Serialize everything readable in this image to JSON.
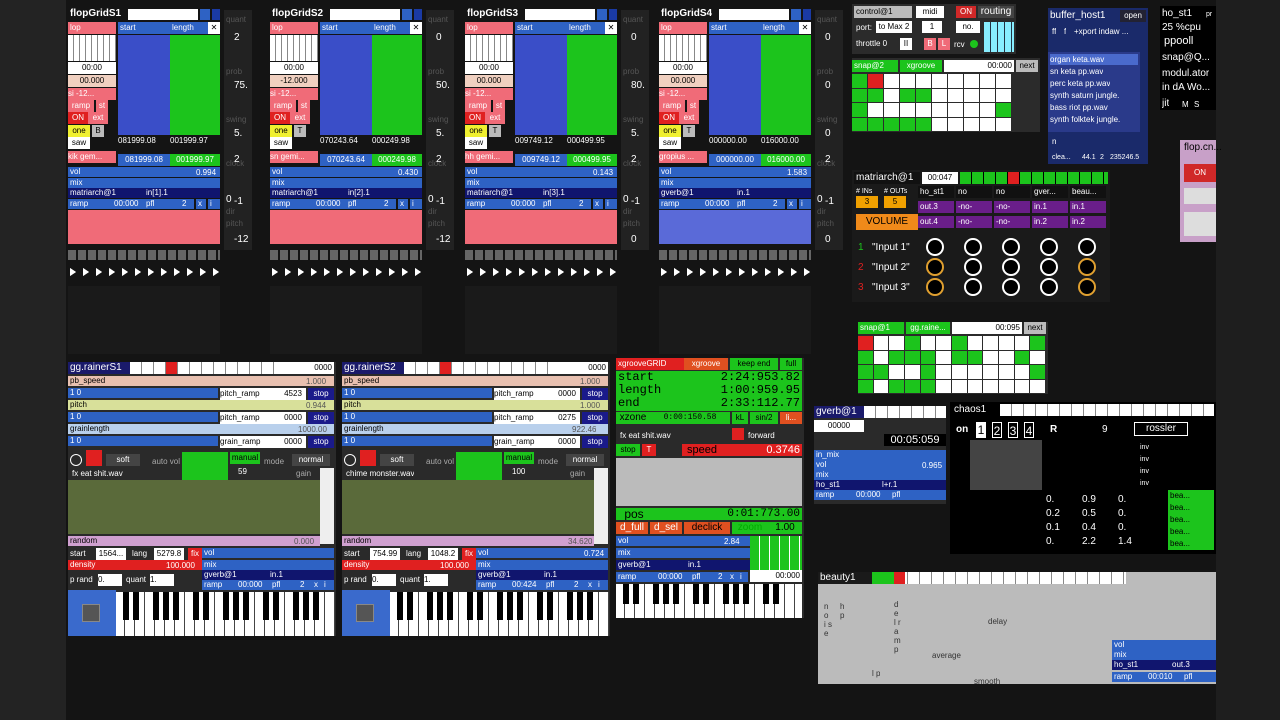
{
  "flopgrids": [
    {
      "title": "flopGridS1",
      "tab_lop": "lop",
      "tab_start": "start",
      "tab_length": "length",
      "time": "00:00",
      "val": "00.000",
      "si": "si -12...",
      "ramp": "ramp",
      "st": "st",
      "on": "ON",
      "ext": "ext",
      "one": "one",
      "b": "B",
      "saw": "saw",
      "name": "kik gem...",
      "n1": "081999.08",
      "n2": "001999.97",
      "n3": "081999.08",
      "n4": "001999.97",
      "vol": "vol",
      "volv": "0.994",
      "mix": "mix",
      "route": "matriarch@1",
      "input": "in[1].1",
      "ramprow": "ramp",
      "rampt": "00:000",
      "pfl": "pfl",
      "two": "2",
      "x": "x",
      "i": "i",
      "side": [
        "quant",
        "2",
        "prob",
        "75.",
        "swing",
        "5.",
        "clock",
        "2",
        "0",
        "-1",
        "dir",
        "pitch",
        "-12"
      ]
    },
    {
      "title": "flopGridS2",
      "tab_lop": "lop",
      "tab_start": "start",
      "tab_length": "length",
      "time": "00:00",
      "val": "-12.000",
      "si": "si -12...",
      "ramp": "ramp",
      "st": "st",
      "on": "ON",
      "ext": "ext",
      "one": "one",
      "b": "T",
      "saw": "saw",
      "name": "sn gemi...",
      "n1": "070243.64",
      "n2": "000249.98",
      "n3": "070243.64",
      "n4": "000249.98",
      "vol": "vol",
      "volv": "0.430",
      "mix": "mix",
      "route": "matriarch@1",
      "input": "in[2].1",
      "ramprow": "ramp",
      "rampt": "00:000",
      "pfl": "pfl",
      "two": "2",
      "x": "x",
      "i": "i",
      "side": [
        "quant",
        "0",
        "prob",
        "50.",
        "swing",
        "5.",
        "clock",
        "2",
        "0",
        "-1",
        "dir",
        "pitch",
        "-12"
      ]
    },
    {
      "title": "flopGridS3",
      "tab_lop": "lop",
      "tab_start": "start",
      "tab_length": "length",
      "time": "00:00",
      "val": "00.000",
      "si": "si -12...",
      "ramp": "ramp",
      "st": "st",
      "on": "ON",
      "ext": "ext",
      "one": "one",
      "b": "T",
      "saw": "saw",
      "name": "hh gemi...",
      "n1": "009749.12",
      "n2": "000499.95",
      "n3": "009749.12",
      "n4": "000499.95",
      "vol": "vol",
      "volv": "0.143",
      "mix": "mix",
      "route": "matriarch@1",
      "input": "in[3].1",
      "ramprow": "ramp",
      "rampt": "00:000",
      "pfl": "pfl",
      "two": "2",
      "x": "x",
      "i": "i",
      "side": [
        "quant",
        "0",
        "prob",
        "80.",
        "swing",
        "5.",
        "clock",
        "2",
        "0",
        "-1",
        "dir",
        "pitch",
        "0"
      ]
    },
    {
      "title": "flopGridS4",
      "tab_lop": "lop",
      "tab_start": "start",
      "tab_length": "length",
      "time": "00:00",
      "val": "00.000",
      "si": "si -12...",
      "ramp": "ramp",
      "st": "st",
      "on": "ON",
      "ext": "ext",
      "one": "one",
      "b": "T",
      "saw": "saw",
      "name": "gropius ...",
      "n1": "000000.00",
      "n2": "016000.00",
      "n3": "000000.00",
      "n4": "016000.00",
      "vol": "vol",
      "volv": "1.583",
      "mix": "mix",
      "route": "gverb@1",
      "input": "in.1",
      "ramprow": "ramp",
      "rampt": "00:000",
      "pfl": "pfl",
      "two": "2",
      "x": "x",
      "i": "i",
      "side": [
        "quant",
        "0",
        "prob",
        "0",
        "swing",
        "0",
        "clock",
        "2",
        "0",
        "-1",
        "dir",
        "pitch",
        "0"
      ]
    }
  ],
  "control": {
    "title": "control@1",
    "midi": "midi",
    "on": "ON",
    "routing": "routing",
    "port": "port:",
    "tomax": "to Max 2",
    "one": "1",
    "no": "no.",
    "throttle": "throttle 0",
    "ii": "II",
    "b": "B",
    "l": "L",
    "rcv": "rcv"
  },
  "buffer": {
    "title": "buffer_host1",
    "open": "open",
    "ff": "ff",
    "f": "f",
    "xport": "+xport indaw ...",
    "files": [
      "organ keta.wav",
      "sn keta pp.wav",
      "perc keta pp.wav",
      "synth saturn jungle.",
      "bass riot pp.wav",
      "synth folktek jungle."
    ],
    "n": "n",
    "clea": "clea...",
    "v1": "44.1",
    "v2": "2",
    "v3": "235246.5"
  },
  "host": {
    "title": "ho_st1",
    "pr": "pr",
    "cpu": "25 %cpu",
    "ppool": "ppooll",
    "snap": "snap@Q...",
    "modul": "modul.ator",
    "inda": "in dA Wo...",
    "jit": "jit",
    "m": "M",
    "s": "S"
  },
  "snap2": {
    "title": "snap@2",
    "xg": "xgroove",
    "time": "00:000",
    "next": "next"
  },
  "flopcn": {
    "title": "flop.cn...",
    "on": "ON"
  },
  "matriarch": {
    "title": "matriarch@1",
    "time": "00:047",
    "ins": "# INs",
    "outs": "# OUTs",
    "inv": "3",
    "outv": "5",
    "volume": "VOLUME",
    "cols": [
      "ho_st1",
      "no",
      "no",
      "gver...",
      "beau..."
    ],
    "row2": [
      "out.3",
      "-no-",
      "-no-",
      "in.1",
      "in.1"
    ],
    "row3": [
      "out.4",
      "-no-",
      "-no-",
      "in.2",
      "in.2"
    ],
    "inputs": [
      {
        "n": "1",
        "label": "\"Input 1\""
      },
      {
        "n": "2",
        "label": "\"Input 2\""
      },
      {
        "n": "3",
        "label": "\"Input 3\""
      }
    ]
  },
  "snap1": {
    "title": "snap@1",
    "gg": "gg.raine...",
    "time": "00:095",
    "next": "next"
  },
  "rainers": [
    {
      "title": "gg.rainerS1",
      "time": "0000",
      "pb": "pb_speed",
      "pbv": "1.000",
      "pitch": "pitch",
      "pitchv": "0.944",
      "gl": "grainlength",
      "glv": "1000.00",
      "r10": "1  0",
      "pr": "pitch_ramp",
      "prv": "4523",
      "stop": "stop",
      "r10b": "1  0",
      "pr2": "pitch_ramp",
      "prv2": "0000",
      "r10c": "1  0",
      "gr": "grain_ramp",
      "grv": "0000",
      "soft": "soft",
      "autovol": "auto vol",
      "manual": "manual",
      "mode": "mode",
      "normal": "normal",
      "mv": "59",
      "gain": "gain",
      "file": "fx eat shit.wav",
      "random": "random",
      "randv": "0.000",
      "start": "start",
      "startv": "1564...",
      "lang": "lang",
      "langv": "5279.8",
      "fix": "fix",
      "density": "density",
      "densv": "100.000",
      "prand": "p rand",
      "prv0": "0.",
      "quant": "quant",
      "qv": "1.",
      "mix": "mix",
      "route": "gverb@1",
      "inp": "in.1",
      "ramp": "ramp",
      "rampt": "00:000",
      "pfl": "pfl",
      "two": "2",
      "x": "x",
      "i": "i",
      "vol": "vol",
      "volv": ""
    },
    {
      "title": "gg.rainerS2",
      "time": "0000",
      "pb": "pb_speed",
      "pbv": "1.000",
      "pitch": "pitch",
      "pitchv": "1.000",
      "gl": "grainlength",
      "glv": "922.46",
      "r10": "1  0",
      "pr": "pitch_ramp",
      "prv": "0000",
      "stop": "stop",
      "r10b": "1  0",
      "pr2": "pitch_ramp",
      "prv2": "0275",
      "r10c": "1  0",
      "gr": "grain_ramp",
      "grv": "0000",
      "soft": "soft",
      "autovol": "auto vol",
      "manual": "manual",
      "mode": "mode",
      "normal": "normal",
      "mv": "100",
      "gain": "gain",
      "file": "chime monster.wav",
      "random": "random",
      "randv": "34.620",
      "start": "start",
      "startv": "754.99",
      "lang": "lang",
      "langv": "1048.2",
      "fix": "fix",
      "density": "density",
      "densv": "100.000",
      "prand": "p rand",
      "prv0": "0.",
      "quant": "quant",
      "qv": "1.",
      "mix": "mix",
      "route": "gverb@1",
      "inp": "in.1",
      "ramp": "ramp",
      "rampt": "00:424",
      "pfl": "pfl",
      "two": "2",
      "x": "x",
      "i": "i",
      "vol": "vol",
      "volv": "0.724"
    }
  ],
  "xgroove": {
    "title": "xgrooveGRID",
    "xg": "xgroove",
    "keep": "keep end",
    "full": "full",
    "start": "start",
    "startv": "2:24:953.82",
    "length": "length",
    "lengthv": "1:00:959.95",
    "end": "end",
    "endv": "2:33:112.77",
    "zone": "xzone",
    "zonev": "0:00:150.58",
    "kl": "kL",
    "sin2": "sin/2",
    "li": "li...",
    "file": "fx eat shit.wav",
    "forward": "forward",
    "stop": "stop",
    "t": "T",
    "speed": "speed",
    "speedv": "0.3746",
    "pos": "pos",
    "posv": "0:01:773.00",
    "dfull": "d_full",
    "dsel": "d_sel",
    "declick": "declick",
    "zoom": "zoom",
    "zoomv": "1.00",
    "vol": "vol",
    "volv": "2.84",
    "mix": "mix",
    "route": "gverb@1",
    "inp": "in.1",
    "ramp": "ramp",
    "rampt": "00:000",
    "pfl": "pfl",
    "two": "2",
    "x": "x",
    "i": "i",
    "time2": "00:000"
  },
  "gverb": {
    "title": "gverb@1",
    "v1": "00000",
    "v2": "00:05:059",
    "inmix": "in_mix",
    "vol": "vol",
    "volv": "0.965",
    "mix": "mix",
    "route": "ho_st1",
    "inp": "l+r.1",
    "ramp": "ramp",
    "rampt": "00:000",
    "pfl": "pfl"
  },
  "chaos": {
    "title": "chaos1",
    "on": "on",
    "n1": "1",
    "n2": "2",
    "n3": "3",
    "n4": "4",
    "r": "R",
    "nine": "9",
    "rossler": "rossler",
    "rows": [
      [
        "0.",
        "0.9",
        "0."
      ],
      [
        "0.2",
        "0.5",
        "0."
      ],
      [
        "0.1",
        "0.4",
        "0."
      ],
      [
        "0.",
        "2.2",
        "1.4"
      ]
    ],
    "beau": [
      "bea...",
      "bea...",
      "bea...",
      "bea...",
      "bea..."
    ],
    "inv": [
      "inv",
      "inv",
      "inv",
      "inv"
    ]
  },
  "beauty": {
    "title": "beauty1",
    "labels": [
      "n o i s e",
      "h p",
      "l p",
      "d e l r a m p",
      "delay",
      "average",
      "smooth"
    ],
    "vol": "vol",
    "mix": "mix",
    "route": "ho_st1",
    "out": "out.3",
    "ramp": "ramp",
    "rampt": "00:010",
    "pfl": "pfl"
  }
}
